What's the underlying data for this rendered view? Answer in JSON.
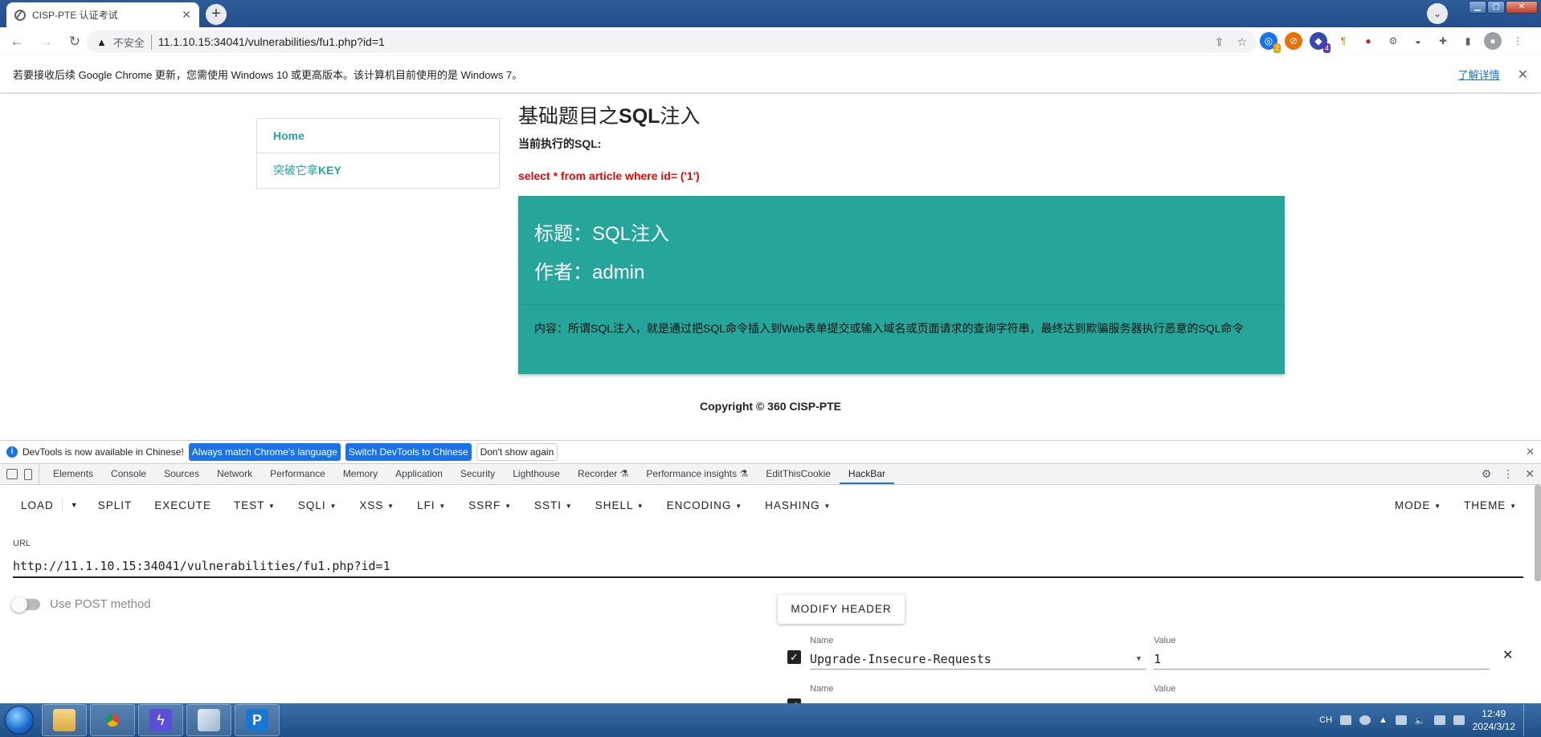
{
  "browser": {
    "tab_title": "CISP-PTE 认证考试",
    "insecure_label": "不安全",
    "url": "11.1.10.15:34041/vulnerabilities/fu1.php?id=1",
    "ext_badges": [
      "2",
      "4"
    ]
  },
  "infobar": {
    "message": "若要接收后续 Google Chrome 更新，您需使用 Windows 10 或更高版本。该计算机目前使用的是 Windows 7。",
    "learn_more": "了解详情"
  },
  "page": {
    "nav": [
      {
        "label": "Home"
      },
      {
        "label_prefix": "突破它拿",
        "label_bold": "KEY"
      }
    ],
    "heading_prefix": "基础题目之",
    "heading_bold": "SQL",
    "heading_suffix": "注入",
    "current_sql_label": "当前执行的SQL:",
    "sql": "select * from article where id= ('1')",
    "card": {
      "title_line": "标题：SQL注入",
      "author_line": "作者：admin",
      "content": "内容：所谓SQL注入，就是通过把SQL命令插入到Web表单提交或输入域名或页面请求的查询字符串，最终达到欺骗服务器执行恶意的SQL命令"
    },
    "copyright": "Copyright © 360 CISP-PTE"
  },
  "devtools": {
    "notice": "DevTools is now available in Chinese!",
    "btn_match": "Always match Chrome's language",
    "btn_switch": "Switch DevTools to Chinese",
    "btn_dismiss": "Don't show again",
    "tabs": [
      "Elements",
      "Console",
      "Sources",
      "Network",
      "Performance",
      "Memory",
      "Application",
      "Security",
      "Lighthouse",
      "Recorder ⚗",
      "Performance insights ⚗",
      "EditThisCookie",
      "HackBar"
    ],
    "active_tab": "HackBar"
  },
  "hackbar": {
    "menu": {
      "load": "LOAD",
      "split": "SPLIT",
      "execute": "EXECUTE",
      "test": "TEST",
      "sqli": "SQLI",
      "xss": "XSS",
      "lfi": "LFI",
      "ssrf": "SSRF",
      "ssti": "SSTI",
      "shell": "SHELL",
      "encoding": "ENCODING",
      "hashing": "HASHING",
      "mode": "MODE",
      "theme": "THEME"
    },
    "url_label": "URL",
    "url_value": "http://11.1.10.15:34041/vulnerabilities/fu1.php?id=1",
    "post_label": "Use POST method",
    "modify_header": "MODIFY HEADER",
    "headers": [
      {
        "name_label": "Name",
        "name": "Upgrade-Insecure-Requests",
        "value_label": "Value",
        "value": "1"
      },
      {
        "name_label": "Name",
        "name": "",
        "value_label": "Value",
        "value": ""
      }
    ]
  },
  "taskbar": {
    "tray_lang": "CH",
    "time": "12:49",
    "date": "2024/3/12"
  }
}
